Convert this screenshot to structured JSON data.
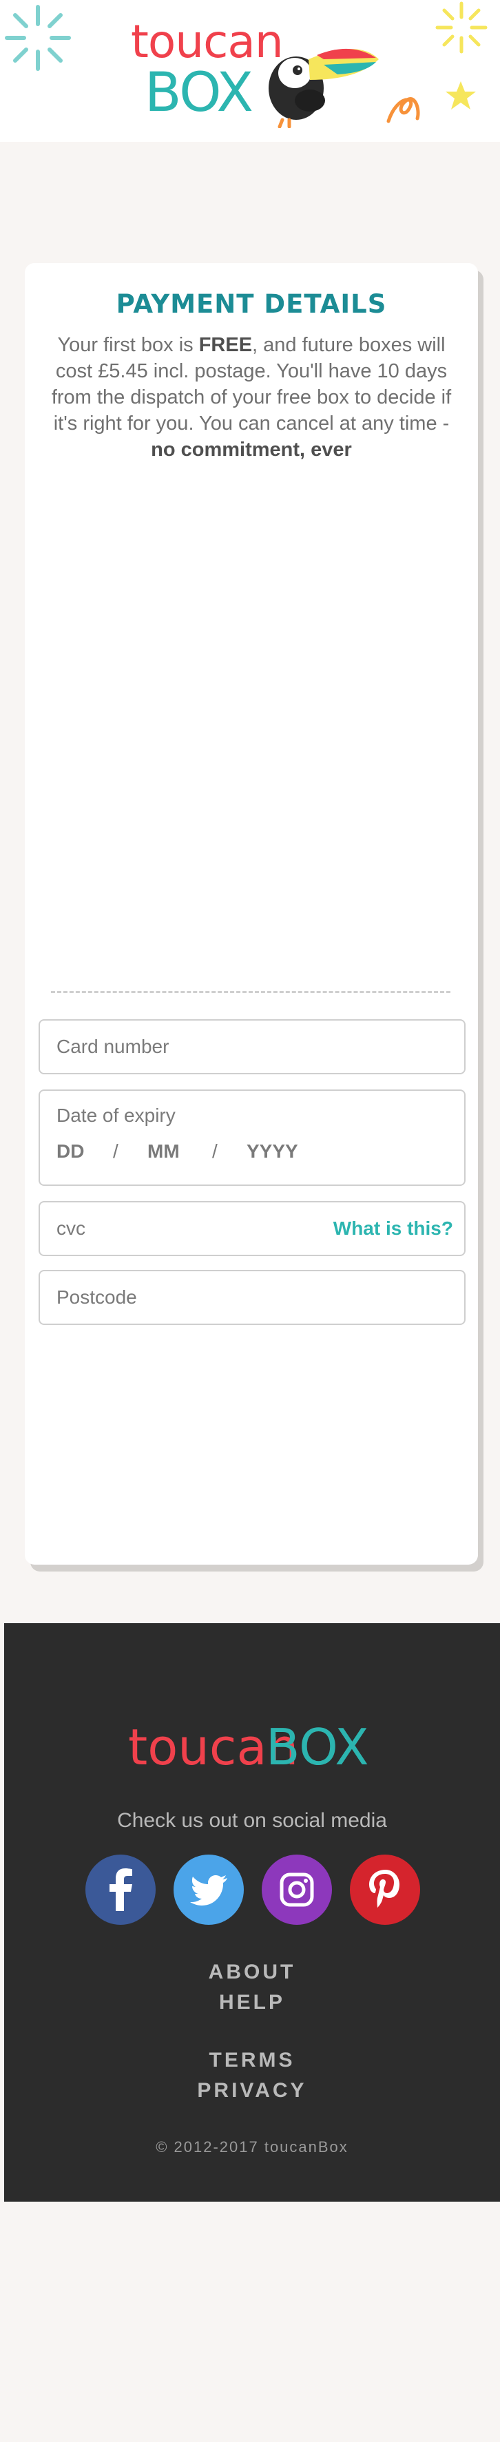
{
  "header": {
    "logo_top": "toucan",
    "logo_bottom": "BOX"
  },
  "payment": {
    "title": "PAYMENT DETAILS",
    "intro_part1": "Your first box is ",
    "intro_bold1": "FREE",
    "intro_part2": ", and future boxes will cost £5.45 incl. postage. You'll have 10 days from the dispatch of your free box to decide if it's right for you. You can cancel at any time - ",
    "intro_bold2": "no commitment, ever",
    "card_number_placeholder": "Card number",
    "expiry_label": "Date of expiry",
    "expiry_dd": "DD",
    "expiry_mm": "MM",
    "expiry_yyyy": "YYYY",
    "expiry_sep": "/",
    "cvc_placeholder": "cvc",
    "cvc_help": "What is this?",
    "postcode_placeholder": "Postcode"
  },
  "footer": {
    "logo_left": "toucan",
    "logo_right": "BOX",
    "social_text": "Check us out on social media",
    "social": [
      "facebook-icon",
      "twitter-icon",
      "instagram-icon",
      "pinterest-icon"
    ],
    "links": {
      "about": "ABOUT",
      "help": "HELP",
      "terms": "TERMS",
      "privacy": "PRIVACY"
    },
    "copyright": "© 2012-2017 toucanBox"
  },
  "colors": {
    "brand_red": "#f0414c",
    "brand_teal": "#2cb5b0",
    "title_teal": "#1c8c95",
    "footer_bg": "#2c2c2c",
    "page_bg": "#f8f5f3"
  }
}
